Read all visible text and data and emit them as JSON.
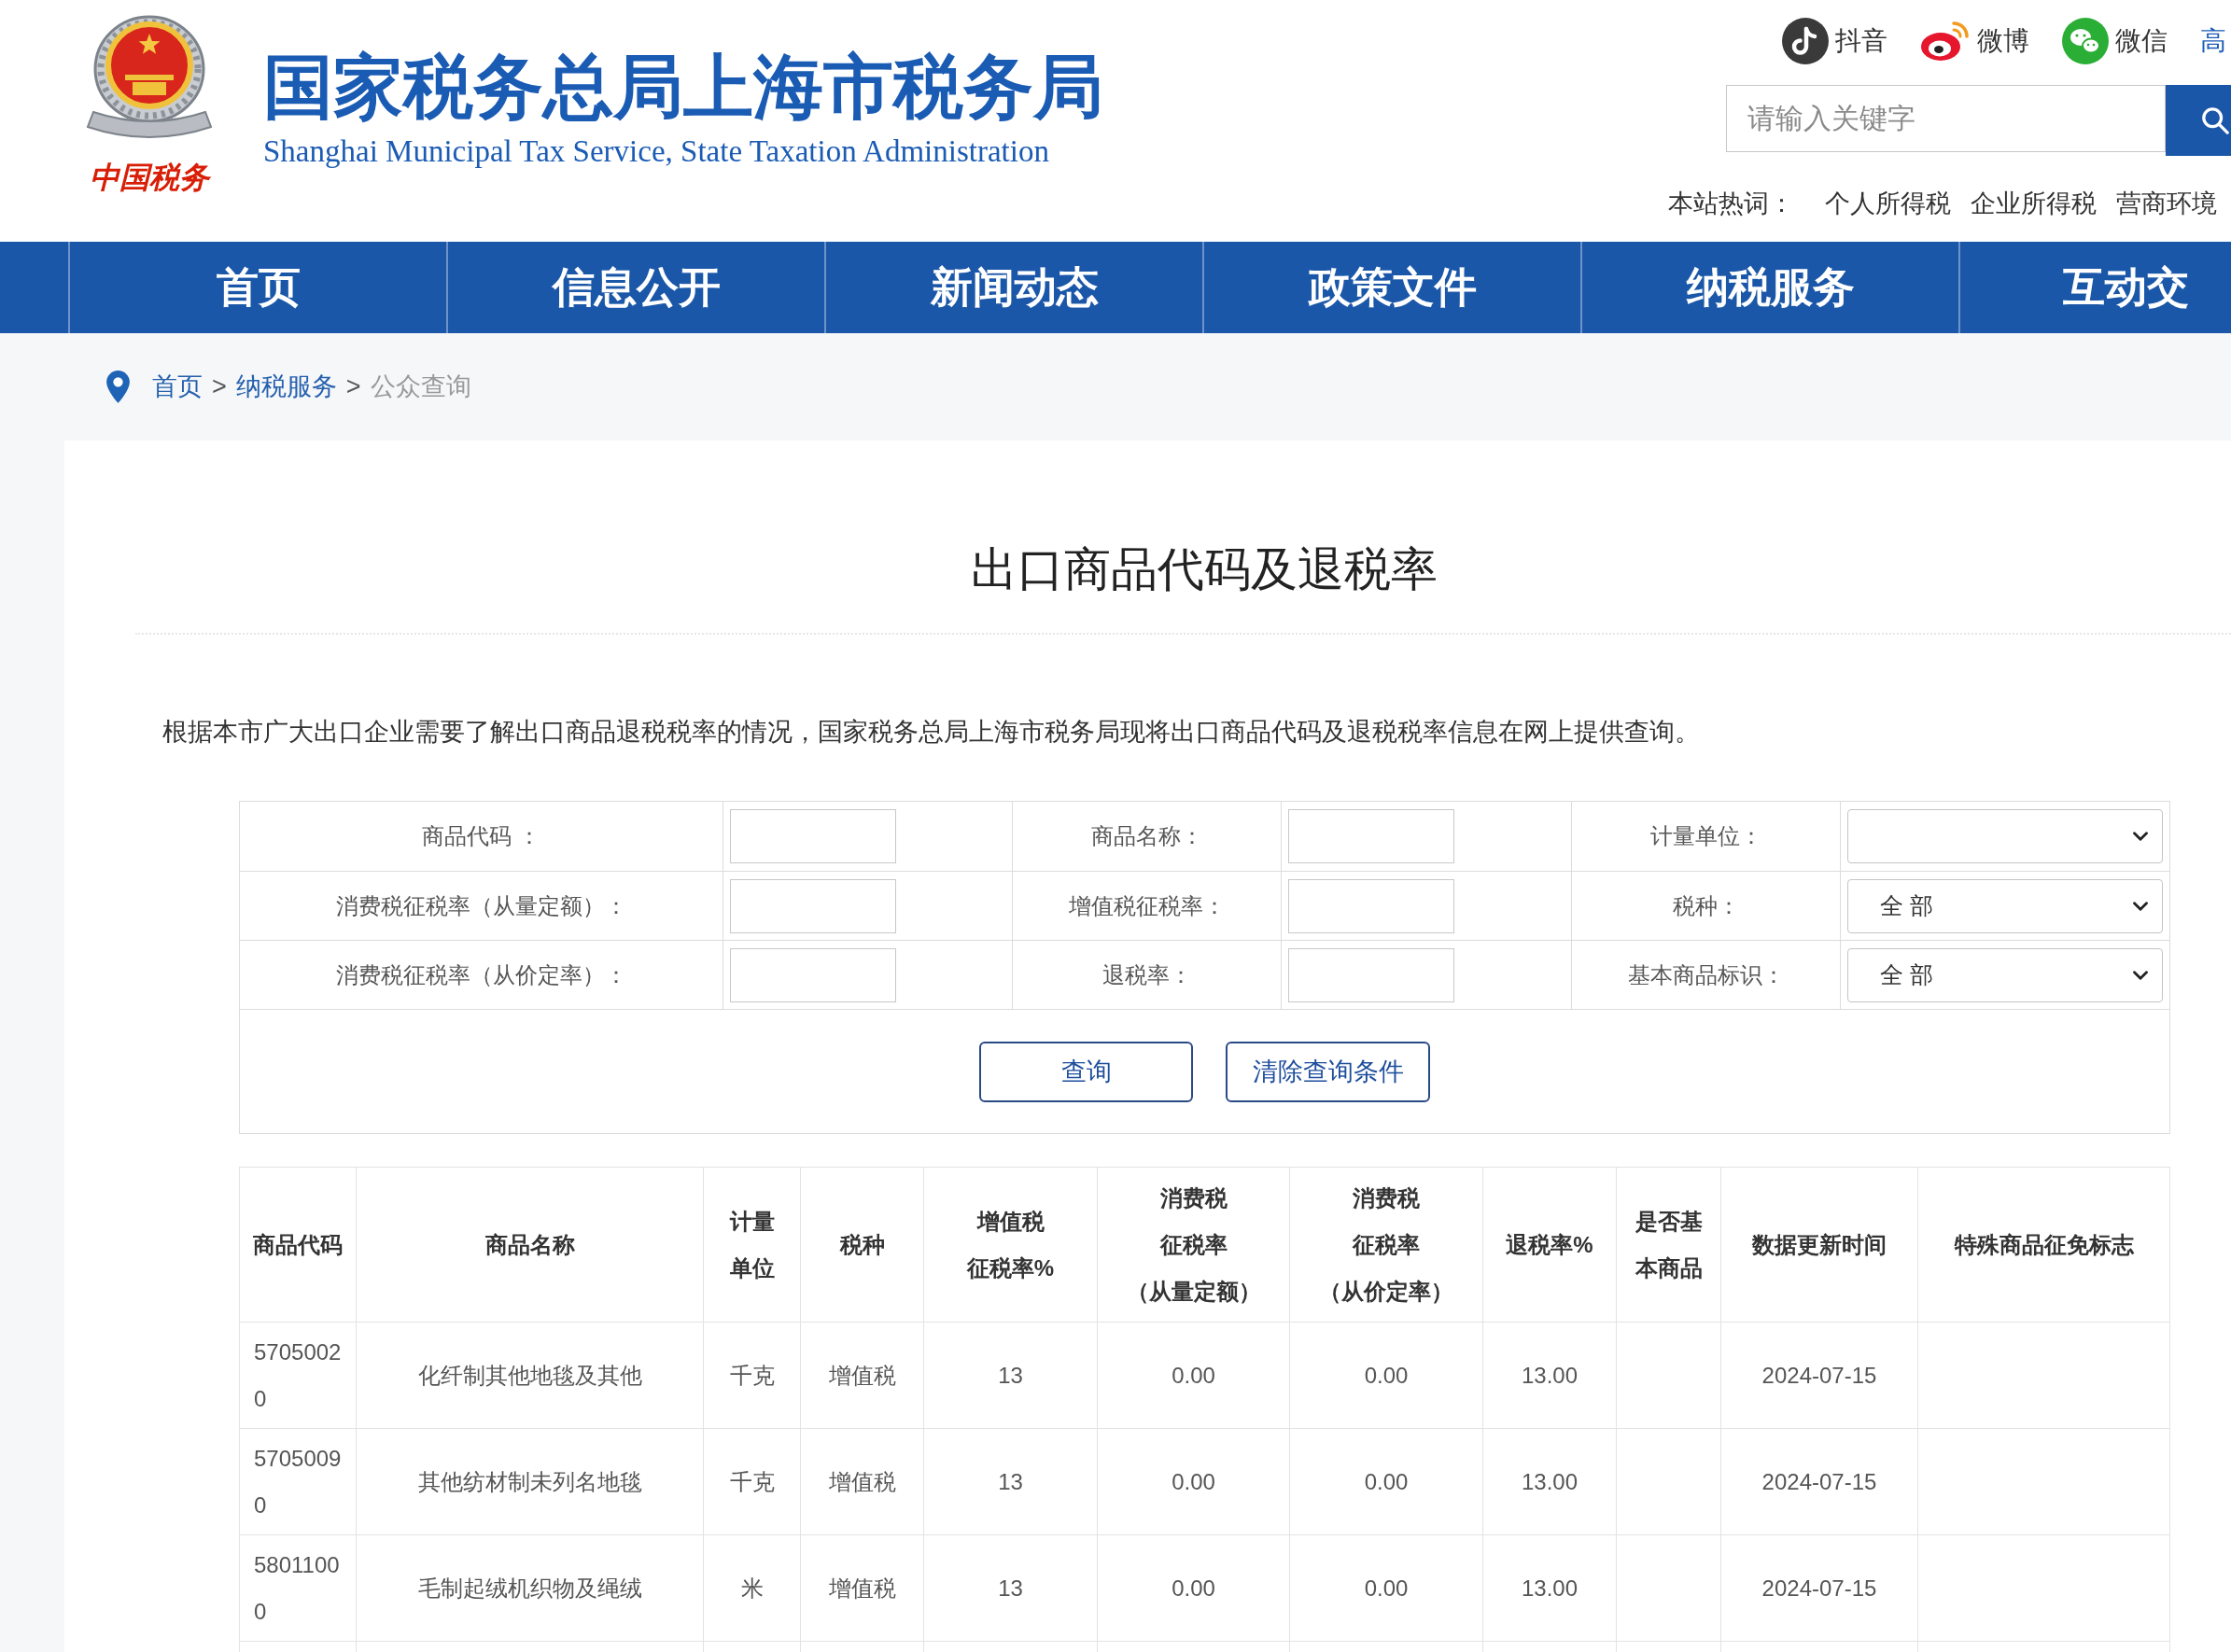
{
  "header": {
    "logo_text": "中国税务",
    "title": "国家税务总局上海市税务局",
    "subtitle": "Shanghai Municipal Tax Service, State Taxation Administration",
    "social_links": [
      {
        "kind": "douyin",
        "label": "抖音"
      },
      {
        "kind": "weibo",
        "label": "微博"
      },
      {
        "kind": "wechat",
        "label": "微信"
      }
    ],
    "edge_link": "高",
    "search": {
      "placeholder": "请输入关键字"
    },
    "hot_words": {
      "label": "本站热词：",
      "items": [
        "个人所得税",
        "企业所得税",
        "营商环境"
      ]
    }
  },
  "nav": {
    "items": [
      {
        "label": "首页"
      },
      {
        "label": "信息公开"
      },
      {
        "label": "新闻动态"
      },
      {
        "label": "政策文件"
      },
      {
        "label": "纳税服务"
      },
      {
        "label": "互动交"
      }
    ]
  },
  "breadcrumb": {
    "items": [
      {
        "kind": "link",
        "label": "首页"
      },
      {
        "kind": "link",
        "label": "纳税服务"
      },
      {
        "kind": "current",
        "label": "公众查询"
      }
    ],
    "separators": [
      ">",
      ">"
    ]
  },
  "page_title": "出口商品代码及退税率",
  "intro": "根据本市广大出口企业需要了解出口商品退税税率的情况，国家税务总局上海市税务局现将出口商品代码及退税税率信息在网上提供查询。",
  "query_form": {
    "rows": [
      [
        {
          "label": "商品代码 ：",
          "kind": "input"
        },
        {
          "label": "商品名称：",
          "kind": "input"
        },
        {
          "label": "计量单位：",
          "kind": "select"
        }
      ],
      [
        {
          "label": "消费税征税率（从量定额）：",
          "kind": "input"
        },
        {
          "label": "增值税征税率：",
          "kind": "input"
        },
        {
          "label": "税种：",
          "kind": "select",
          "value": "全 部"
        }
      ],
      [
        {
          "label": "消费税征税率（从价定率）：",
          "kind": "input"
        },
        {
          "label": "退税率：",
          "kind": "input"
        },
        {
          "label": "基本商品标识：",
          "kind": "select",
          "value": "全 部"
        }
      ]
    ],
    "buttons": [
      {
        "label": "查询"
      },
      {
        "label": "清除查询条件"
      }
    ]
  },
  "results_table": {
    "columns": [
      {
        "label": "商品代码"
      },
      {
        "label": "商品名称"
      },
      {
        "label": "计量单位"
      },
      {
        "label": "税种"
      },
      {
        "label": "增值税征税率%"
      },
      {
        "label": "消费税征税率",
        "note": "（从量定额）"
      },
      {
        "label": "消费税征税率",
        "note": "（从价定率）"
      },
      {
        "label": "退税率%"
      },
      {
        "label": "是否基本商品"
      },
      {
        "label": "数据更新时间"
      },
      {
        "label": "特殊商品征免标志"
      }
    ],
    "rows": [
      [
        "57050020",
        "化纤制其他地毯及其他",
        "千克",
        "增值税",
        "13",
        "0.00",
        "0.00",
        "13.00",
        null,
        "2024-07-15",
        null
      ],
      [
        "57050090",
        "其他纺材制未列名地毯",
        "千克",
        "增值税",
        "13",
        "0.00",
        "0.00",
        "13.00",
        null,
        "2024-07-15",
        null
      ],
      [
        "58011000",
        "毛制起绒机织物及绳绒",
        "米",
        "增值税",
        "13",
        "0.00",
        "0.00",
        "13.00",
        null,
        "2024-07-15",
        null
      ]
    ]
  }
}
